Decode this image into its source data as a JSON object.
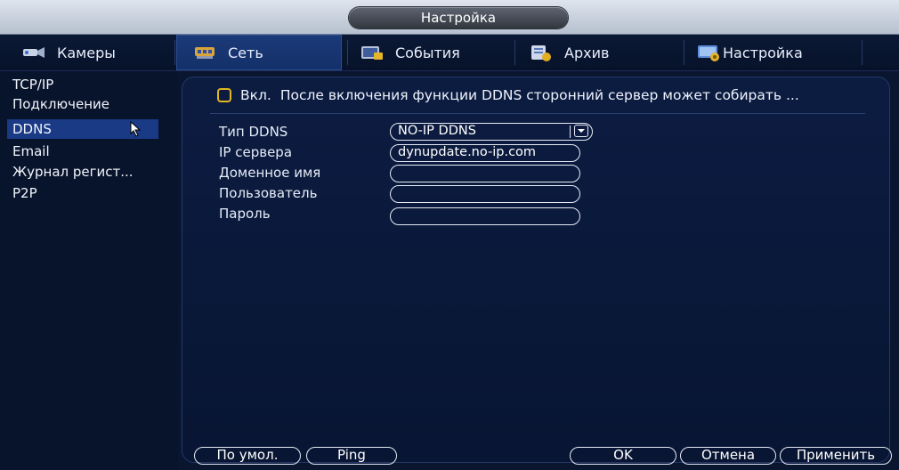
{
  "window": {
    "title": "Настройка"
  },
  "tabs": [
    {
      "label": "Камеры",
      "icon": "camera-icon"
    },
    {
      "label": "Сеть",
      "icon": "network-icon",
      "active": true
    },
    {
      "label": "События",
      "icon": "events-icon"
    },
    {
      "label": "Архив",
      "icon": "archive-icon"
    },
    {
      "label": "Настройка",
      "icon": "settings-icon"
    }
  ],
  "sidebar": {
    "items": [
      {
        "label": "TCP/IP"
      },
      {
        "label": "Подключение"
      },
      {
        "label": "DDNS",
        "active": true
      },
      {
        "label": "Email"
      },
      {
        "label": "Журнал регист..."
      },
      {
        "label": "P2P"
      }
    ]
  },
  "ddns": {
    "enable_label": "Вкл.",
    "enable_note": "После включения функции DDNS сторонний сервер может собирать ...",
    "enabled": false,
    "fields": {
      "type_label": "Тип DDNS",
      "type_value": "NO-IP DDNS",
      "server_label": "IP сервера",
      "server_value": "dynupdate.no-ip.com",
      "domain_label": "Доменное имя",
      "domain_value": "",
      "user_label": "Пользователь",
      "user_value": "",
      "password_label": "Пароль",
      "password_value": ""
    }
  },
  "buttons": {
    "default": "По умол.",
    "ping": "Ping",
    "ok": "OK",
    "cancel": "Отмена",
    "apply": "Применить"
  },
  "colors": {
    "background": "#0a1530",
    "active_tab": "#1c3a78",
    "active_sidebar": "#1a3a85",
    "checkbox": "#e1b520"
  }
}
